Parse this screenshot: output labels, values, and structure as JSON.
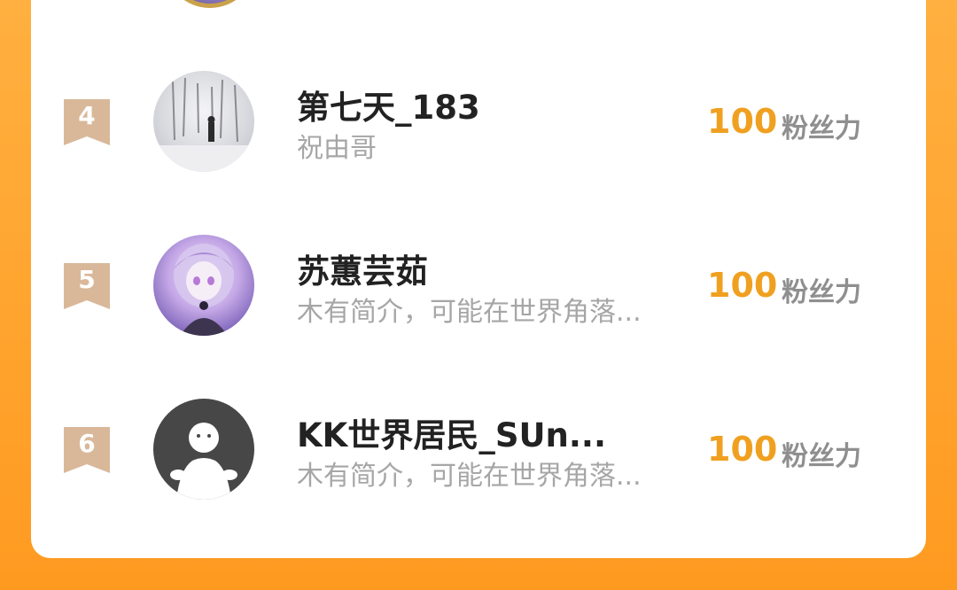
{
  "colors": {
    "accent_orange": "#ff9a20",
    "score_color": "#f0a020",
    "badge_color": "#d9b89a"
  },
  "fan_list": {
    "rows": [
      {
        "rank": "4",
        "name": "第七天_183",
        "subtitle": "祝由哥",
        "score": "100",
        "unit": "粉丝力",
        "avatar": "snowy-forest-photo"
      },
      {
        "rank": "5",
        "name": "苏蕙芸茹",
        "subtitle": "木有简介，可能在世界角落...",
        "score": "100",
        "unit": "粉丝力",
        "avatar": "anime-girl-illustration"
      },
      {
        "rank": "6",
        "name": "KK世界居民_SUn...",
        "subtitle": "木有简介，可能在世界角落...",
        "score": "100",
        "unit": "粉丝力",
        "avatar": "default-user-icon"
      }
    ]
  }
}
